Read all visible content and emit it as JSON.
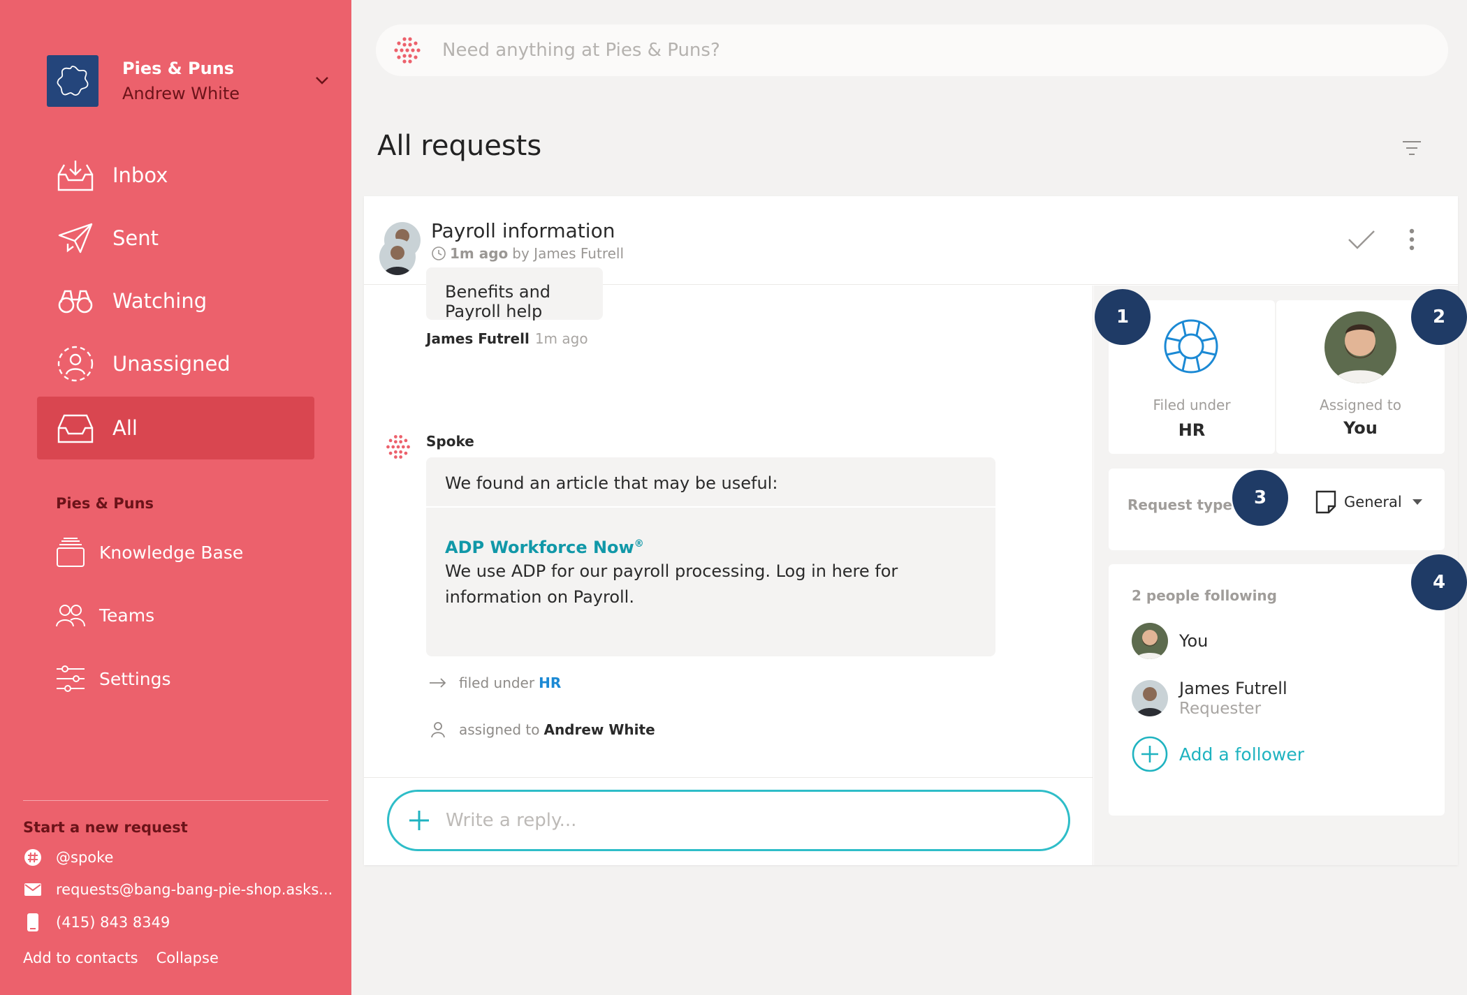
{
  "workspace": {
    "name": "Pies & Puns",
    "user": "Andrew White"
  },
  "nav": [
    {
      "label": "Inbox",
      "icon": "inbox-icon"
    },
    {
      "label": "Sent",
      "icon": "paper-plane-icon"
    },
    {
      "label": "Watching",
      "icon": "binoculars-icon"
    },
    {
      "label": "Unassigned",
      "icon": "unassigned-user-icon"
    },
    {
      "label": "All",
      "icon": "tray-icon",
      "active": true
    }
  ],
  "section_label": "Pies & Puns",
  "secondary_nav": [
    {
      "label": "Knowledge Base",
      "icon": "stack-icon"
    },
    {
      "label": "Teams",
      "icon": "people-icon"
    },
    {
      "label": "Settings",
      "icon": "sliders-icon"
    }
  ],
  "start_request": {
    "label": "Start a new request",
    "slack": "@spoke",
    "email": "requests@bang-bang-pie-shop.asks...",
    "phone": "(415) 843 8349"
  },
  "footer": {
    "add_contacts": "Add to contacts",
    "collapse": "Collapse"
  },
  "search": {
    "placeholder": "Need anything at Pies & Puns?"
  },
  "page_title": "All requests",
  "request": {
    "title": "Payroll information",
    "time": "1m ago",
    "by": "by James Futrell"
  },
  "thread": {
    "msg1": {
      "author": "James Futrell",
      "time": "1m ago",
      "text": "Benefits and Payroll help"
    },
    "msg2": {
      "author": "Spoke",
      "intro": "We found an article that may be useful:",
      "article_title": "ADP Workforce Now",
      "article_mark": "®",
      "article_text": "We use ADP for our payroll processing. Log in here for information on Payroll."
    },
    "event_filed": {
      "prefix": "filed under",
      "value": "HR"
    },
    "event_assigned": {
      "prefix": "assigned to",
      "value": "Andrew White"
    },
    "reply_placeholder": "Write a reply..."
  },
  "details": {
    "filed_caption": "Filed under",
    "filed_value": "HR",
    "assigned_caption": "Assigned to",
    "assigned_value": "You",
    "request_type_label": "Request type",
    "request_type_value": "General"
  },
  "followers": {
    "title": "2 people following",
    "items": [
      {
        "name": "You",
        "role": ""
      },
      {
        "name": "James Futrell",
        "role": "Requester"
      }
    ],
    "add_label": "Add a follower"
  },
  "badges": [
    "1",
    "2",
    "3",
    "4"
  ],
  "colors": {
    "sidebar": "#ec616c",
    "active": "#d94650",
    "accent": "#1fb3c0",
    "badge": "#1f3b66",
    "link": "#1b89d4"
  }
}
